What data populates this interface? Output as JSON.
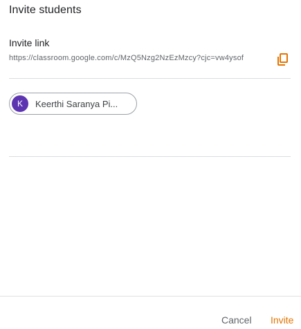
{
  "dialog": {
    "title": "Invite students",
    "link_label": "Invite link",
    "link_url": "https://classroom.google.com/c/MzQ5Nzg2NzEzMzcy?cjc=vw4ysof",
    "copy_icon": "copy-icon"
  },
  "chips": [
    {
      "initial": "K",
      "name": "Keerthi Saranya Pi...",
      "avatar_color": "#5e35b1"
    }
  ],
  "footer": {
    "cancel_label": "Cancel",
    "invite_label": "Invite",
    "invite_color": "#e37400"
  }
}
